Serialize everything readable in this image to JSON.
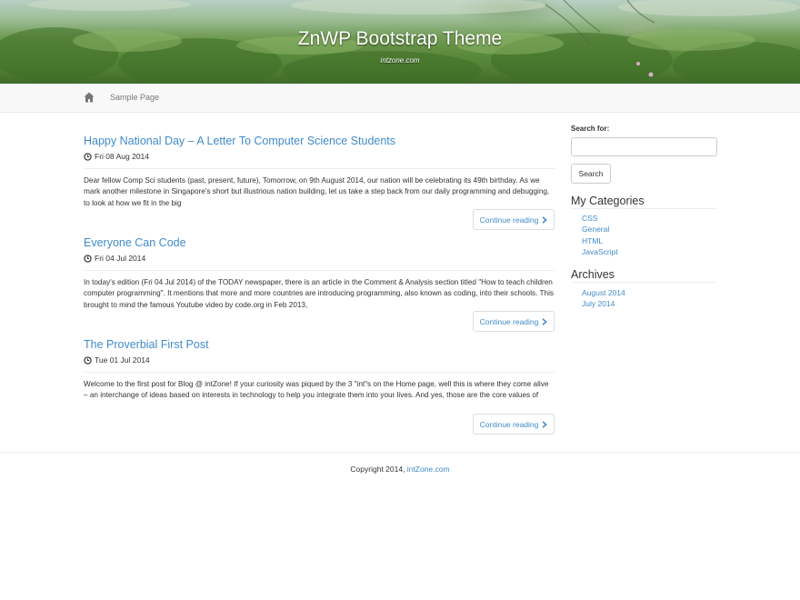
{
  "header": {
    "title": "ZnWP Bootstrap Theme",
    "tagline": "intzone.com"
  },
  "nav": {
    "home_icon": "home-icon",
    "items": [
      {
        "label": "Sample Page"
      }
    ]
  },
  "posts": [
    {
      "title": "Happy National Day – A Letter To Computer Science Students",
      "date": "Fri 08 Aug 2014",
      "excerpt": "Dear fellow Comp Sci students (past, present, future),   Tomorrow, on 9th August 2014, our nation will be celebrating its 49th birthday. As we mark another milestone in Singapore's short but illustrious nation building, let us take a step back from our daily programming and debugging, to look at how we fit in the big",
      "continue_label": "Continue reading"
    },
    {
      "title": "Everyone Can Code",
      "date": "Fri 04 Jul 2014",
      "excerpt": "In today's edition (Fri 04 Jul 2014) of the TODAY newspaper, there is an article in the Comment & Analysis section titled \"How to teach children computer programming\". It mentions that more and more countries are introducing programming, also known as coding, into their schools. This brought to mind the famous Youtube video by code.org in Feb 2013,",
      "continue_label": "Continue reading"
    },
    {
      "title": "The Proverbial First Post",
      "date": "Tue 01 Jul 2014",
      "excerpt": "Welcome to the first post for Blog @ intZone!  If your curiosity was piqued by the 3 \"int\"s on the Home page, well this is where they come alive – an interchange of ideas based on interests in technology to help you integrate them into your lives. And yes, those are the core values of",
      "continue_label": "Continue reading"
    }
  ],
  "sidebar": {
    "search_label": "Search for:",
    "search_value": "",
    "search_button": "Search",
    "categories_title": "My Categories",
    "categories": [
      "CSS",
      "General",
      "HTML",
      "JavaScript"
    ],
    "archives_title": "Archives",
    "archives": [
      "August 2014",
      "July 2014"
    ]
  },
  "footer": {
    "copyright_prefix": "Copyright 2014, ",
    "copyright_link": "intZone.com"
  },
  "colors": {
    "link": "#428bca",
    "text": "#333333",
    "navbar_bg": "#f8f8f8"
  }
}
